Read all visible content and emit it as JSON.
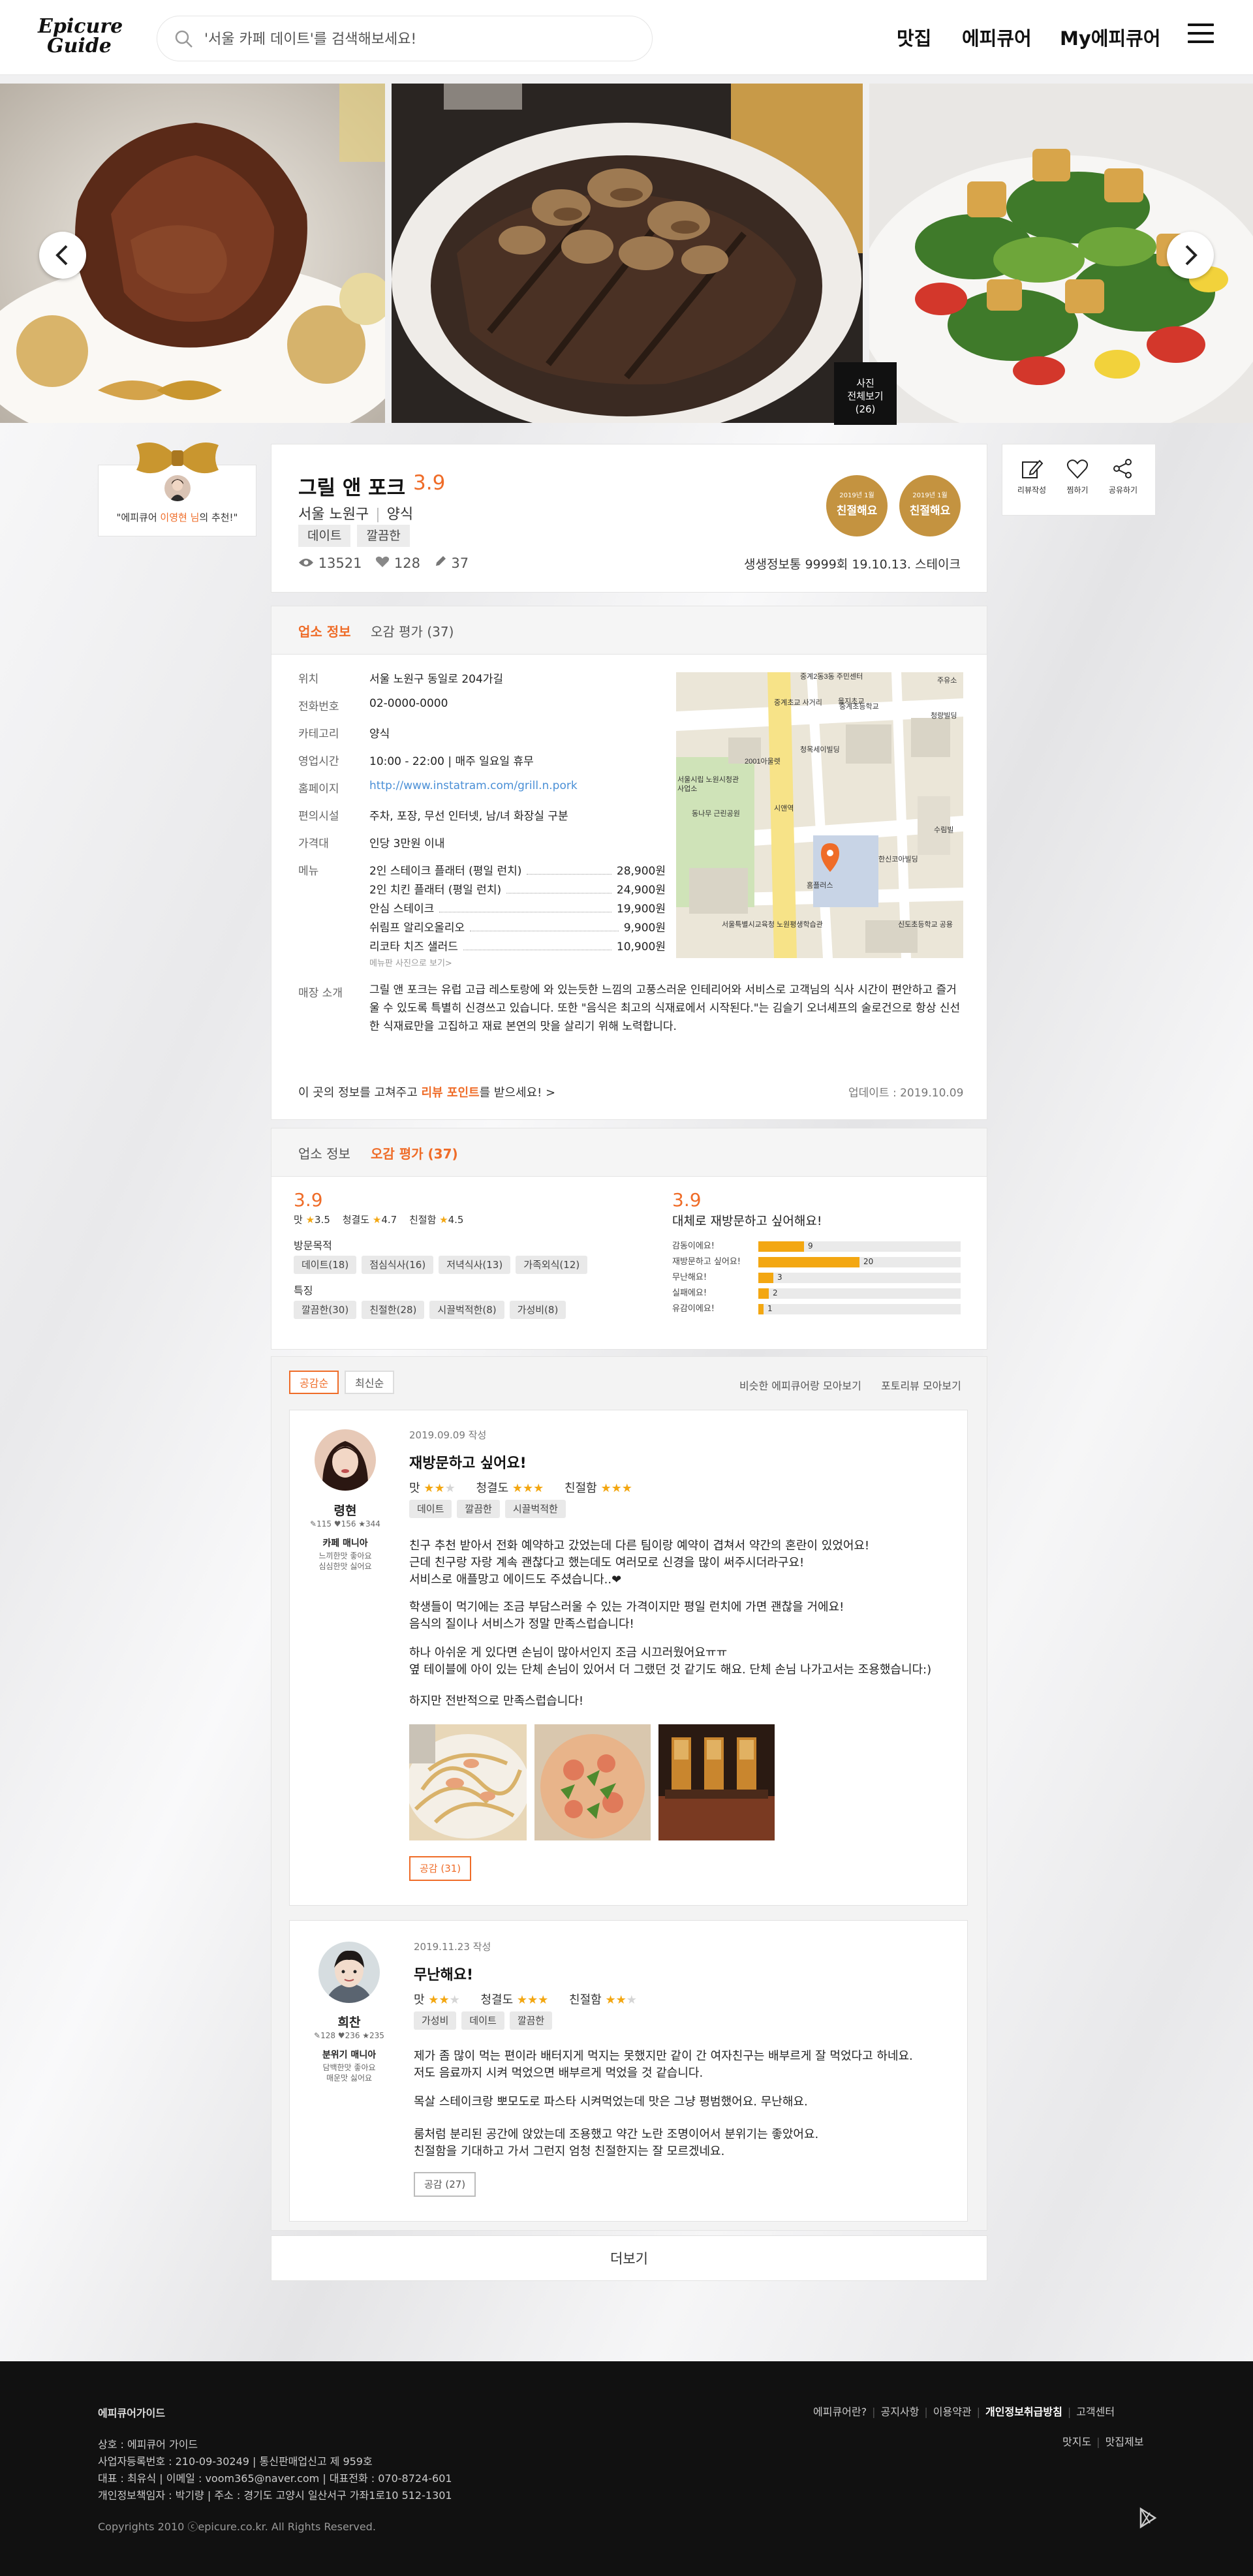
{
  "header": {
    "logo_line1": "Epicure",
    "logo_line2": "Guide",
    "search_placeholder": "'서울 카페 데이트'를 검색해보세요!",
    "nav": [
      "맛집",
      "에피큐어",
      "My에피큐어"
    ]
  },
  "gallery": {
    "photo_all_label": "사진\n전체보기\n(26)",
    "photo_all_line1": "사진",
    "photo_all_line2": "전체보기",
    "photo_all_line3": "(26)"
  },
  "recommend": {
    "text_prefix": "\"에피큐어 ",
    "name": "이영현 님",
    "text_suffix": "의 추천!\""
  },
  "restaurant": {
    "name": "그릴 앤 포크",
    "score": "3.9",
    "district": "서울 노원구",
    "category": "양식",
    "tags": [
      "데이트",
      "깔끔한"
    ],
    "views": "13521",
    "likes": "128",
    "reviews": "37",
    "registration": "생생정보통 9999회 19.10.13. 스테이크",
    "badges": [
      {
        "top": "2019년 1월",
        "label": "친절해요"
      },
      {
        "top": "2019년 1월",
        "label": "친절해요"
      }
    ],
    "actions": [
      "리뷰작성",
      "찜하기",
      "공유하기"
    ]
  },
  "info": {
    "tabs": [
      "업소 정보",
      "오감 평가 (37)"
    ],
    "rows": [
      {
        "label": "위치",
        "value": "서울 노원구 동일로 204가길"
      },
      {
        "label": "전화번호",
        "value": "02-0000-0000"
      },
      {
        "label": "카테고리",
        "value": "양식"
      },
      {
        "label": "영업시간",
        "value": "10:00 - 22:00 | 매주 일요일 휴무"
      },
      {
        "label": "홈페이지",
        "value": "http://www.instatram.com/grill.n.pork"
      },
      {
        "label": "편의시설",
        "value": "주차, 포장, 무선 인터넷, 남/녀 화장실 구분"
      },
      {
        "label": "가격대",
        "value": "인당 3만원 이내"
      }
    ],
    "menu_label": "메뉴",
    "menu": [
      {
        "name": "2인 스테이크 플래터 (평일 런치)",
        "price": "28,900원"
      },
      {
        "name": "2인 치킨 플래터 (평일 런치)",
        "price": "24,900원"
      },
      {
        "name": "안심 스테이크",
        "price": "19,900원"
      },
      {
        "name": "쉬림프 알리오올리오",
        "price": "9,900원"
      },
      {
        "name": "리코타 치즈 샐러드",
        "price": "10,900원"
      }
    ],
    "menu_note": "메뉴판 사진으로 보기>",
    "desc_label": "매장 소개",
    "desc": "그릴 앤 포크는 유럽 고급 레스토랑에 와 있는듯한 느낌의 고풍스러운 인테리어와 서비스로 고객님의 식사 시간이 편안하고 즐거울 수 있도록 특별히 신경쓰고 있습니다. 또한 \"음식은 최고의 식재료에서 시작된다.\"는 김슬기 오너셰프의 술로건으로 항상 신선한 식재료만을 고집하고 재료 본연의 맛을 살리기 위해 노력합니다.",
    "correction_prefix": "이 곳의 정보를 고쳐주고 ",
    "correction_link": "리뷰 포인트",
    "correction_suffix": "를 받으세요! >",
    "updated": "업데이트 : 2019.10.09",
    "map_labels": [
      "중계2동3동 주민센터",
      "중계초교 사거리",
      "을지초교",
      "중계초등학교",
      "청량빌딩",
      "주유소",
      "2001아울렛",
      "청목세이빌딩",
      "서울시립 노원시청관",
      "사업소",
      "동나무 근린공원",
      "시앤역",
      "수림빌",
      "홈플러스",
      "한신코아빌딩",
      "서울특별시교육청 노원평생학습관",
      "신도초등학교 공용"
    ]
  },
  "rating": {
    "tabs": [
      "업소 정보",
      "오감 평가 (37)"
    ],
    "score": "3.9",
    "taste_label": "맛",
    "taste": "3.5",
    "clean_label": "청결도",
    "clean": "4.7",
    "kind_label": "친절함",
    "kind": "4.5",
    "purpose_label": "방문목적",
    "purposes": [
      "데이트(18)",
      "점심식사(16)",
      "저녁식사(13)",
      "가족외식(12)"
    ],
    "feature_label": "특징",
    "features": [
      "깔끔한(30)",
      "친절한(28)",
      "시끌벅적한(8)",
      "가성비(8)"
    ],
    "right_score": "3.9",
    "right_title": "대체로 재방문하고 싶어해요!",
    "chart_data": {
      "type": "bar",
      "categories": [
        "감동이에요!",
        "재방문하고 싶어요!",
        "무난해요!",
        "실패에요!",
        "유감이에요!"
      ],
      "values": [
        9,
        20,
        3,
        2,
        1
      ],
      "xlim": [
        0,
        40
      ]
    }
  },
  "reviews": {
    "sort": [
      "공감순",
      "최신순"
    ],
    "links": [
      "비슷한 에피큐어랑 모아보기",
      "포토리뷰 모아보기"
    ],
    "items": [
      {
        "date": "2019.09.09 작성",
        "title": "재방문하고 싶어요!",
        "name": "령현",
        "meta": "✎115  ♥156  ★344",
        "level": "카페 매니아",
        "sub1": "느끼한맛 좋아요",
        "sub2": "심심한맛 싫어요",
        "taste_label": "맛",
        "taste_stars": 2,
        "clean_label": "청결도",
        "clean_stars": 3,
        "kind_label": "친절함",
        "kind_stars": 3,
        "tags": [
          "데이트",
          "깔끔한",
          "시끌벅적한"
        ],
        "paragraphs": [
          "친구 추천 받아서 전화 예약하고 갔었는데 다른 팀이랑 예약이 겹쳐서 약간의 혼란이 있었어요!\n근데 친구랑 자랑 계속 괜찮다고 했는데도 여러모로 신경을 많이 써주시더라구요!\n서비스로 애플망고 에이드도 주셨습니다..❤",
          "학생들이 먹기에는 조금 부담스러울 수 있는 가격이지만 평일 런치에 가면 괜찮을 거에요!\n음식의 질이나 서비스가 정말 만족스럽습니다!",
          "하나 아쉬운 게 있다면 손님이 많아서인지 조금 시끄러웠어요ㅠㅠ\n옆 테이블에 아이 있는 단체 손님이 있어서 더 그랬던 것 같기도 해요. 단체 손님 나가고서는 조용했습니다:)",
          "하지만 전반적으로 만족스럽습니다!"
        ],
        "like": "공감 (31)"
      },
      {
        "date": "2019.11.23 작성",
        "title": "무난해요!",
        "name": "희찬",
        "meta": "✎128  ♥236  ★235",
        "level": "분위기 매니아",
        "sub1": "담백한맛 좋아요",
        "sub2": "매운맛 싫어요",
        "taste_label": "맛",
        "taste_stars": 2,
        "clean_label": "청결도",
        "clean_stars": 3,
        "kind_label": "친절함",
        "kind_stars": 2,
        "tags": [
          "가성비",
          "데이트",
          "깔끔한"
        ],
        "paragraphs": [
          "제가 좀 많이 먹는 편이라 배터지게 먹지는 못했지만 같이 간 여자친구는 배부르게 잘 먹었다고 하네요.\n저도 음료까지 시켜 먹었으면 배부르게 먹었을 것 같습니다.",
          "목살 스테이크랑 뽀모도로 파스타 시켜먹었는데 맛은 그냥 평범했어요. 무난해요.",
          "룸처럼 분리된 공간에 앉았는데 조용했고 약간 노란 조명이어서 분위기는 좋았어요.\n친절함을 기대하고 가서 그런지 엄청 친절한지는 잘 모르겠네요."
        ],
        "like": "공감 (27)"
      }
    ],
    "more": "더보기"
  },
  "footer": {
    "brand": "에피큐어가이드",
    "links": [
      "에피큐어란?",
      "공지사항",
      "이용약관",
      "개인정보취급방침",
      "고객센터"
    ],
    "links2": [
      "맛지도",
      "맛집제보"
    ],
    "company": "상호 : 에피큐어 가이드",
    "biz": "사업자등록번호 : 210-09-30249  |  통신판매업신고 제 959호",
    "ceo": "대표 : 최유식  |  이메일 : voom365@naver.com  |  대표전화 : 070-8724-601",
    "privacy": "개인정보책임자 : 박기량  |  주소 : 경기도 고양시 일산서구 가좌1로10 512-1301",
    "copyright": "Copyrights 2010 ⓒepicure.co.kr. All Rights Reserved."
  },
  "colors": {
    "accent": "#ef6c28",
    "star": "#f3a712",
    "badge": "#c49340",
    "footer": "#111111"
  }
}
